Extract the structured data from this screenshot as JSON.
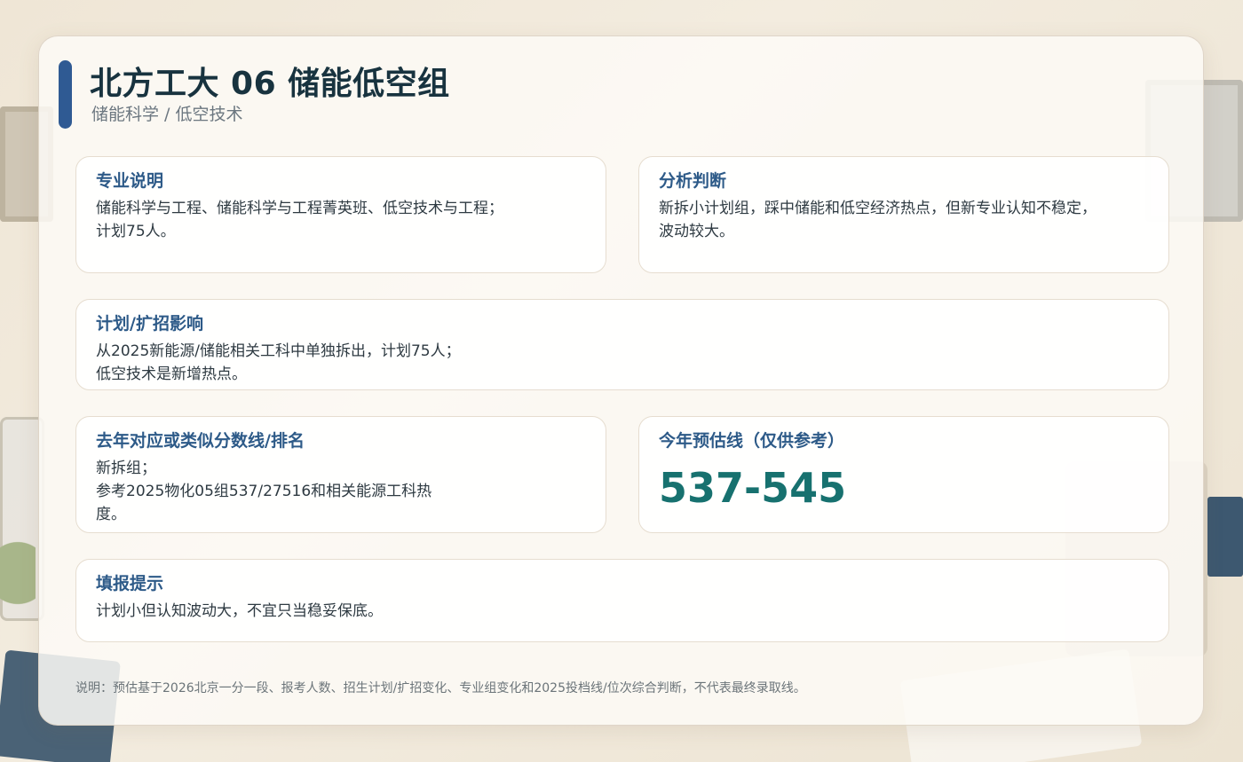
{
  "header": {
    "title": "北方工大 06 储能低空组",
    "subtitle": "储能科学 / 低空技术"
  },
  "cards": {
    "major_desc": {
      "title": "专业说明",
      "body": "储能科学与工程、储能科学与工程菁英班、低空技术与工程；\n计划75人。"
    },
    "analysis": {
      "title": "分析判断",
      "body": "新拆小计划组，踩中储能和低空经济热点，但新专业认知不稳定，波动较大。"
    },
    "plan_impact": {
      "title": "计划/扩招影响",
      "body": "从2025新能源/储能相关工科中单独拆出，计划75人；\n低空技术是新增热点。"
    },
    "last_year": {
      "title": "去年对应或类似分数线/排名",
      "body": "新拆组；\n参考2025物化05组537/27516和相关能源工科热度。"
    },
    "estimate": {
      "title": "今年预估线（仅供参考）",
      "value": "537-545"
    },
    "tips": {
      "title": "填报提示",
      "body": "计划小但认知波动大，不宜只当稳妥保底。"
    }
  },
  "footnote": "说明：预估基于2026北京一分一段、报考人数、招生计划/扩招变化、专业组变化和2025投档线/位次综合判断，不代表最终录取线。",
  "colors": {
    "accent": "#2f5a93",
    "title": "#18333f",
    "card_title": "#2d5a88",
    "estimate": "#17716f"
  }
}
